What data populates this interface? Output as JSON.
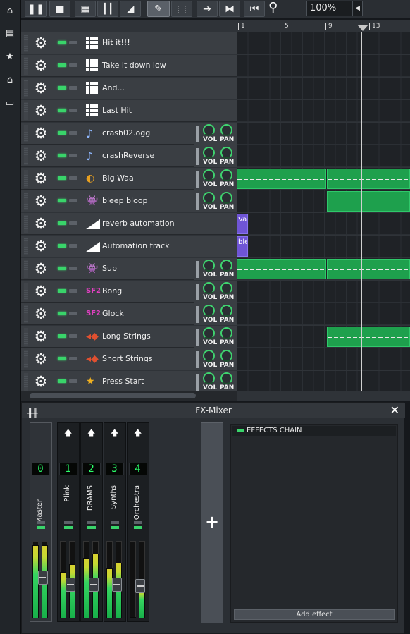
{
  "sidebar": {
    "icons": [
      "home-icon",
      "file-icon",
      "star-file-icon",
      "store-icon",
      "monitor-icon"
    ]
  },
  "toolbar": {
    "zoom": "100%",
    "buttons": [
      "pause",
      "stop",
      "add-beat",
      "add-sample",
      "add-automation",
      "draw",
      "select",
      "move-right",
      "mirror",
      "rewind"
    ]
  },
  "ruler": {
    "ticks": [
      "1",
      "5",
      "9",
      "13"
    ]
  },
  "tracks": [
    {
      "name": "Hit it!!!",
      "type": "beat",
      "knobs": false
    },
    {
      "name": "Take it down low",
      "type": "beat",
      "knobs": false
    },
    {
      "name": "And...",
      "type": "beat",
      "knobs": false
    },
    {
      "name": "Last Hit",
      "type": "beat",
      "knobs": false
    },
    {
      "name": "crash02.ogg",
      "type": "sample",
      "knobs": true
    },
    {
      "name": "crashReverse",
      "type": "sample",
      "knobs": true
    },
    {
      "name": "Big Waa",
      "type": "instrument",
      "knobs": true
    },
    {
      "name": "bleep bloop",
      "type": "instrument",
      "knobs": true
    },
    {
      "name": "reverb automation",
      "type": "automation",
      "knobs": false,
      "clip": "Va"
    },
    {
      "name": "Automation track",
      "type": "automation",
      "knobs": false,
      "clip": "ble"
    },
    {
      "name": "Sub",
      "type": "instrument",
      "knobs": true
    },
    {
      "name": "Bong",
      "type": "sf2",
      "knobs": true
    },
    {
      "name": "Glock",
      "type": "sf2",
      "knobs": true
    },
    {
      "name": "Long Strings",
      "type": "instrument",
      "knobs": true
    },
    {
      "name": "Short Strings",
      "type": "instrument",
      "knobs": true
    },
    {
      "name": "Press Start",
      "type": "instrument",
      "knobs": true
    }
  ],
  "knob_labels": {
    "vol": "VOL",
    "pan": "PAN"
  },
  "fx_mixer": {
    "title": "FX-Mixer",
    "channels": [
      {
        "num": "0",
        "name": "Master"
      },
      {
        "num": "1",
        "name": "Plink"
      },
      {
        "num": "2",
        "name": "DRAMS"
      },
      {
        "num": "3",
        "name": "Synths"
      },
      {
        "num": "4",
        "name": "Orchestra"
      }
    ],
    "add_channel": "+",
    "effects_chain": "EFFECTS CHAIN",
    "add_effect": "Add effect"
  },
  "colors": {
    "accent_green": "#39d46a",
    "pattern_green": "#1ea04d",
    "automation_purple": "#6f55d6"
  }
}
